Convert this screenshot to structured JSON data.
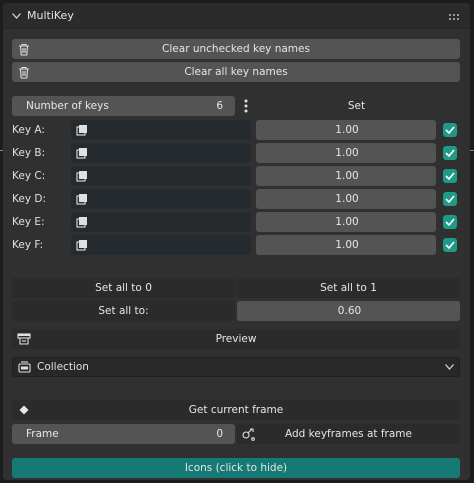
{
  "panel": {
    "title": "MultiKey"
  },
  "buttons": {
    "clear_unchecked": "Clear unchecked key names",
    "clear_all": "Clear all key names",
    "set": "Set",
    "set_all_0": "Set all to 0",
    "set_all_1": "Set all to 1",
    "preview": "Preview",
    "get_current_frame": "Get current frame",
    "add_keyframes": "Add keyframes at frame",
    "icons_toggle": "Icons (click to hide)"
  },
  "num_keys": {
    "label": "Number of keys",
    "value": "6"
  },
  "keys": [
    {
      "label": "Key A:",
      "value": "1.00",
      "checked": true
    },
    {
      "label": "Key B:",
      "value": "1.00",
      "checked": true
    },
    {
      "label": "Key C:",
      "value": "1.00",
      "checked": true
    },
    {
      "label": "Key D:",
      "value": "1.00",
      "checked": true
    },
    {
      "label": "Key E:",
      "value": "1.00",
      "checked": true
    },
    {
      "label": "Key F:",
      "value": "1.00",
      "checked": true
    }
  ],
  "set_all_to": {
    "label": "Set all to:",
    "value": "0.60"
  },
  "collection": {
    "selected": "Collection"
  },
  "frame": {
    "label": "Frame",
    "value": "0"
  },
  "icons": {
    "collapse": "chevron-down-icon",
    "grip": "drag-grip-icon",
    "trash": "trash-icon",
    "menu": "vertical-dots-icon",
    "shape_key": "shape-key-icon",
    "preview": "render-icon",
    "collection": "collection-icon",
    "keyframe": "keyframe-diamond-icon",
    "add_keyframe": "add-keyframe-icon"
  },
  "colors": {
    "accent": "#1f9a87",
    "toggle": "#147a73",
    "button": "#545454",
    "panel": "#303030"
  }
}
